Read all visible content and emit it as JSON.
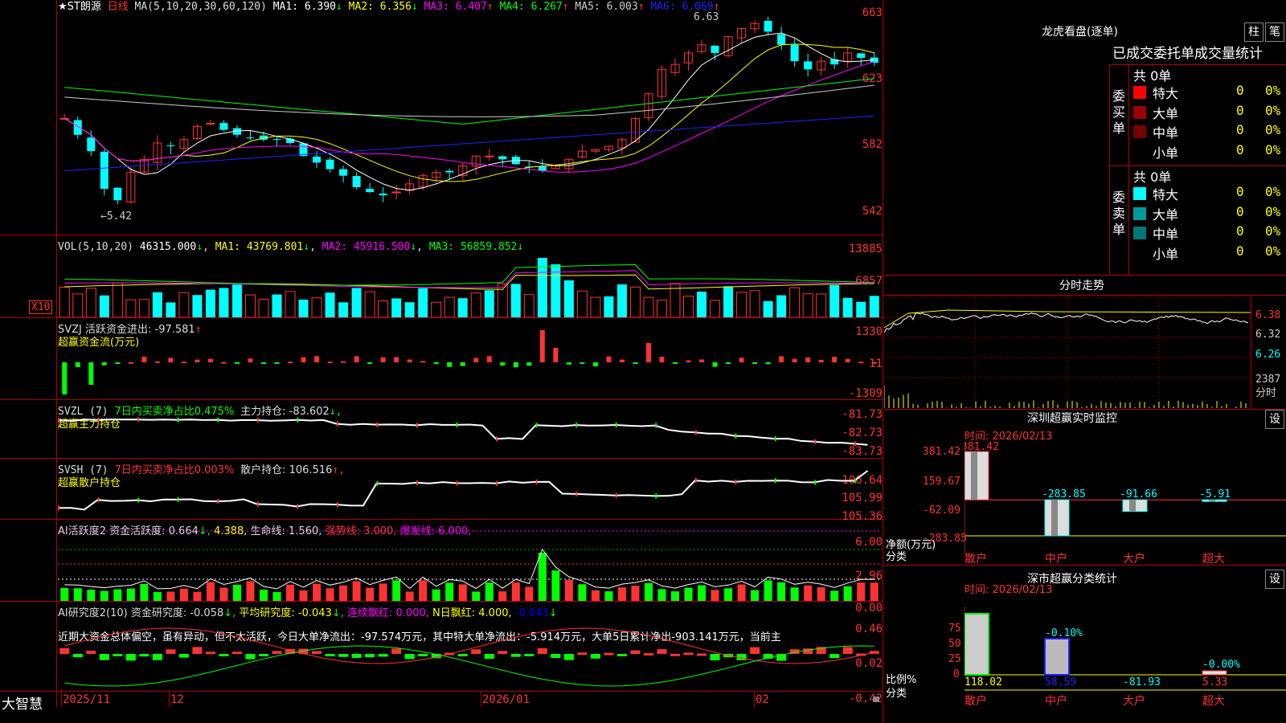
{
  "main": {
    "stock_title": "★ST朗源",
    "period": "日线",
    "ma_spec": "MA(5,10,20,30,60,120)",
    "ma_items": [
      {
        "label": "MA1:",
        "value": "6.390",
        "arrow": "↓",
        "color": "#ffffff"
      },
      {
        "label": "MA2:",
        "value": "6.356",
        "arrow": "↓",
        "color": "#ffff00"
      },
      {
        "label": "MA3:",
        "value": "6.407",
        "arrow": "↑",
        "color": "#ff00ff"
      },
      {
        "label": "MA4:",
        "value": "6.267",
        "arrow": "↑",
        "color": "#00ff00"
      },
      {
        "label": "MA5:",
        "value": "6.003",
        "arrow": "↑",
        "color": "#cccccc"
      },
      {
        "label": "MA6:",
        "value": "6.069",
        "arrow": "↑",
        "color": "#2222ff"
      }
    ],
    "y_labels": [
      "663",
      "623",
      "582",
      "542"
    ],
    "high_mark": "6.63",
    "low_mark": "←5.42"
  },
  "vol": {
    "spec": "VOL(5,10,20)",
    "value": "46315.000",
    "value_arrow": "↓",
    "ma1": "MA1: 43769.801",
    "ma2": "MA2: 45916.500",
    "ma3": "MA3: 56859.852",
    "y_labels": [
      "13885",
      "6857"
    ],
    "unit": "X10"
  },
  "svzj": {
    "title": "SVZJ  活跃资金进出: -97.581",
    "arrow": "↑",
    "subtitle": "超赢资金流(万元)",
    "y_labels": [
      "1330",
      "11",
      "-1309"
    ]
  },
  "svzl": {
    "title_a": "SVZL (7)",
    "title_b": "7日内买卖净占比0.475%",
    "title_c": "主力持仓: -83.602",
    "arrow": "↓,",
    "subtitle": "超赢主力持仓",
    "y_labels": [
      "-81.73",
      "-82.73",
      "-83.73"
    ]
  },
  "svsh": {
    "title_a": "SVSH (7)",
    "title_b": "7日内买卖净占比0.003%",
    "title_c": "散户持仓: 106.516",
    "arrow": "↑,",
    "subtitle": "超赢散户持仓",
    "y_labels": [
      "106.64",
      "105.99",
      "105.36"
    ]
  },
  "ai1": {
    "title": "AI活跃度2",
    "a": "资金活跃度: 0.664",
    "a_arrow": "↓,",
    "b": "4.388,",
    "c": "生命线: 1.560,",
    "d": "强势线: 3.000,",
    "e": "爆发线: 6.000,",
    "y_labels": [
      "6.00",
      "2.96",
      "0.00"
    ]
  },
  "ai2": {
    "title": "AI研究度2(10)",
    "a": "资金研究度: -0.058",
    "a_arrow": "↓,",
    "b": "平均研究度: -0.043",
    "b_arrow": "↓,",
    "c": "连续飘红: 0.000,",
    "d": "N日飘红: 4.000,",
    "e": "-0.043",
    "e_arrow": "↓",
    "y_labels": [
      "0.46",
      "0.02",
      "-0.42"
    ],
    "summary": "近期大资金总体偏空，虽有异动，但不太活跃，今日大单净流出：-97.574万元，其中特大单净流出：-5.914万元，大单5日累计净出-903.141万元，当前主"
  },
  "bottom": {
    "brand": "大智慧",
    "dates": [
      "2025/11",
      "12",
      "2026/01",
      "02"
    ]
  },
  "right": {
    "lhb_title": "龙虎看盘(逐单)",
    "btn_zhu": "柱",
    "btn_bi": "笔",
    "tabs_text": "已成交委托单成交量统计",
    "buy_side": "委买单",
    "sell_side": "委卖单",
    "buy_total": "共 0单",
    "sell_total": "共 0单",
    "levels": [
      "特大",
      "大单",
      "中单",
      "小单"
    ],
    "zero": "0",
    "pct": "0%",
    "buy_colors": [
      "#ff0000",
      "#990000",
      "#770000",
      "#000000"
    ],
    "sell_colors": [
      "#00ffff",
      "#009999",
      "#007777",
      "#000000"
    ],
    "intraday_title": "分时走势",
    "intraday_y": [
      "6.38",
      "6.32",
      "6.26"
    ],
    "intraday_vol_top": "2387",
    "intraday_vol_label": "分时",
    "sz_title": "深圳超赢实时监控",
    "set_btn": "设",
    "sz_time": "时间: 2026/02/13",
    "sz_y": [
      "381.42",
      "159.67",
      "-62.09",
      "-283.85"
    ],
    "sz_values": [
      "381.42",
      "-283.85",
      "-91.66",
      "-5.91"
    ],
    "sz_unit": "净额(万元)",
    "sz_cat_label": "分类",
    "categories": [
      "散户",
      "中户",
      "大户",
      "超大"
    ],
    "sh_title": "深市超赢分类统计",
    "sh_time": "时间: 2026/02/13",
    "sh_y": [
      "75",
      "50",
      "25",
      "0"
    ],
    "sh_pct_labels": [
      "-0.10%",
      "-0.00%"
    ],
    "sh_values": [
      "118.02",
      "58.59",
      "-81.93",
      "5.33"
    ],
    "sh_unit": "比例%",
    "sh_cat_label": "分类"
  },
  "chart_data": [
    {
      "type": "line",
      "title": "★ST朗源 日线",
      "x": [
        "2025/11",
        "12",
        "2026/01",
        "02"
      ],
      "series": [
        {
          "name": "MA1",
          "values": [
            6.39
          ]
        },
        {
          "name": "MA2",
          "values": [
            6.356
          ]
        },
        {
          "name": "MA3",
          "values": [
            6.407
          ]
        },
        {
          "name": "MA4",
          "values": [
            6.267
          ]
        },
        {
          "name": "MA5",
          "values": [
            6.003
          ]
        },
        {
          "name": "MA6",
          "values": [
            6.069
          ]
        }
      ],
      "ylim": [
        5.42,
        6.63
      ]
    },
    {
      "type": "bar",
      "title": "深圳超赢实时监控",
      "categories": [
        "散户",
        "中户",
        "大户",
        "超大"
      ],
      "values": [
        381.42,
        -283.85,
        -91.66,
        -5.91
      ],
      "ylim": [
        -283.85,
        381.42
      ],
      "ylabel": "净额(万元)"
    },
    {
      "type": "bar",
      "title": "深市超赢分类统计",
      "categories": [
        "散户",
        "中户",
        "大户",
        "超大"
      ],
      "values": [
        118.02,
        58.59,
        -81.93,
        5.33
      ],
      "ylabel": "比例%"
    }
  ]
}
